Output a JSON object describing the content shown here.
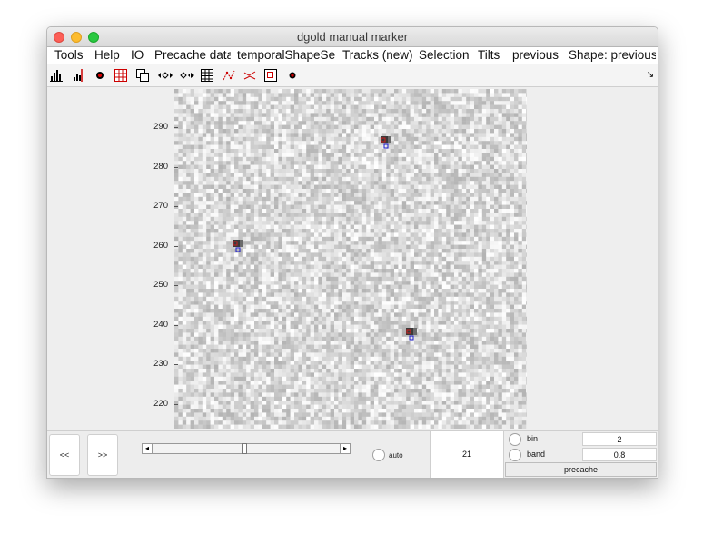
{
  "window": {
    "title": "dgold manual marker"
  },
  "menubar": {
    "items": [
      "Tools",
      "Help",
      "IO",
      "Precache data",
      "temporalShapeSe",
      "Tracks (new)",
      "Selection",
      "Tilts",
      "previous",
      "Shape: previous"
    ]
  },
  "toolbar": {
    "buttons": [
      {
        "icon": "histogram-icon"
      },
      {
        "icon": "histogram-cursor-icon"
      },
      {
        "icon": "red-dot-icon"
      },
      {
        "icon": "grid-red-icon"
      },
      {
        "icon": "copy-windows-icon"
      },
      {
        "icon": "diamond-arrows-icon"
      },
      {
        "icon": "diamond-arrows-right-icon"
      },
      {
        "icon": "table-icon"
      },
      {
        "icon": "scatter-lines-icon"
      },
      {
        "icon": "lines-icon"
      },
      {
        "icon": "box-select-icon"
      },
      {
        "icon": "marker-dot-icon"
      }
    ],
    "overflow_glyph": "↘"
  },
  "axes": {
    "y_ticks": [
      "290",
      "280",
      "270",
      "260",
      "250",
      "240",
      "230",
      "220"
    ]
  },
  "colors": {
    "marker_red": "#d02020",
    "marker_blue": "#1c1ccc"
  },
  "navigation": {
    "prev_label": "<<",
    "next_label": ">>",
    "slider_left": "◂",
    "slider_right": "▸",
    "slider_position": 0.49
  },
  "auto": {
    "label": "auto"
  },
  "frame": {
    "value": "21"
  },
  "params": {
    "bin": {
      "label": "bin",
      "value": "2"
    },
    "band": {
      "label": "band",
      "value": "0.8"
    },
    "precache_label": "precache"
  }
}
